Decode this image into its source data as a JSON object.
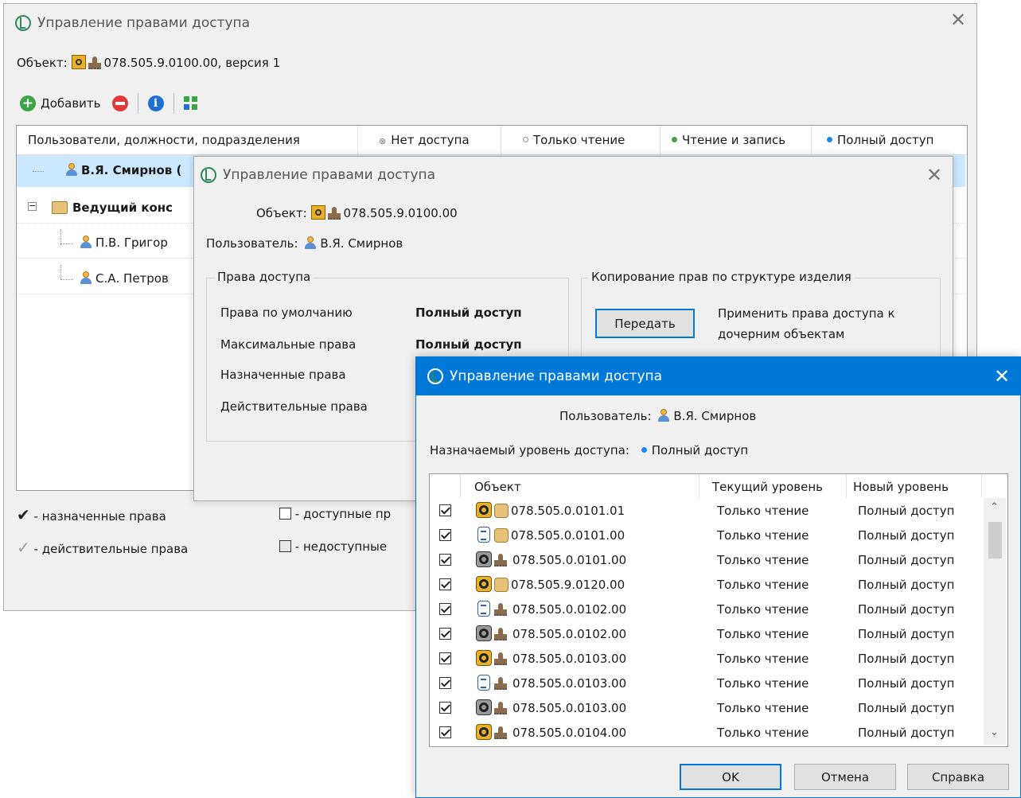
{
  "main_window": {
    "title": "Управление правами доступа",
    "object_label": "Объект:",
    "object_value": "078.505.9.0100.00, версия 1",
    "toolbar": {
      "add_label": "Добавить"
    },
    "columns": [
      "Пользователи, должности, подразделения",
      "Нет доступа",
      "Только чтение",
      "Чтение и запись",
      "Полный доступ"
    ],
    "tree": [
      {
        "label": "В.Я. Смирнов (",
        "type": "user"
      },
      {
        "label": "Ведущий конс",
        "type": "position"
      },
      {
        "label": "П.В. Григор",
        "type": "user"
      },
      {
        "label": "С.А. Петров",
        "type": "user"
      }
    ],
    "legend": {
      "assigned": "- назначенные права",
      "effective": "- действительные права",
      "available": "- доступные пр",
      "unavailable": "- недоступные"
    }
  },
  "second_window": {
    "title": "Управление правами доступа",
    "object_label": "Объект:",
    "object_value": "078.505.9.0100.00",
    "user_label": "Пользователь:",
    "user_value": "В.Я. Смирнов",
    "rights_group": "Права доступа",
    "rights": [
      {
        "label": "Права по умолчанию",
        "value": "Полный доступ"
      },
      {
        "label": "Максимальные права",
        "value": "Полный доступ"
      },
      {
        "label": "Назначенные права",
        "value": ""
      },
      {
        "label": "Действительные права",
        "value": ""
      }
    ],
    "copy_group": "Копирование прав по структуре изделия",
    "transfer_button": "Передать",
    "transfer_desc_1": "Применить права доступа к",
    "transfer_desc_2": "дочерним объектам"
  },
  "front_window": {
    "title": "Управление правами доступа",
    "user_label": "Пользователь:",
    "user_value": "В.Я. Смирнов",
    "level_label": "Назначаемый уровень доступа:",
    "level_value": "Полный доступ",
    "columns": {
      "object": "Объект",
      "current": "Текущий уровень",
      "new": "Новый уровень"
    },
    "rows": [
      {
        "icon1": "project-icon",
        "icon2": "box-icon",
        "name": "078.505.0.0101.01",
        "current": "Только чтение",
        "new": "Полный доступ",
        "checked": true
      },
      {
        "icon1": "document-icon",
        "icon2": "box-icon",
        "name": "078.505.0.0101.00",
        "current": "Только чтение",
        "new": "Полный доступ",
        "checked": true
      },
      {
        "icon1": "gray-project-icon",
        "icon2": "stamp-icon",
        "name": "078.505.0.0101.00",
        "current": "Только чтение",
        "new": "Полный доступ",
        "checked": true
      },
      {
        "icon1": "project-icon",
        "icon2": "box-icon",
        "name": "078.505.9.0120.00",
        "current": "Только чтение",
        "new": "Полный доступ",
        "checked": true
      },
      {
        "icon1": "document-icon",
        "icon2": "stamp-icon",
        "name": "078.505.0.0102.00",
        "current": "Только чтение",
        "new": "Полный доступ",
        "checked": true
      },
      {
        "icon1": "gray-project-icon",
        "icon2": "stamp-icon",
        "name": "078.505.0.0102.00",
        "current": "Только чтение",
        "new": "Полный доступ",
        "checked": true
      },
      {
        "icon1": "project-icon",
        "icon2": "stamp-icon",
        "name": "078.505.0.0103.00",
        "current": "Только чтение",
        "new": "Полный доступ",
        "checked": true
      },
      {
        "icon1": "document-icon",
        "icon2": "stamp-icon",
        "name": "078.505.0.0103.00",
        "current": "Только чтение",
        "new": "Полный доступ",
        "checked": true
      },
      {
        "icon1": "gray-project-icon",
        "icon2": "stamp-icon",
        "name": "078.505.0.0103.00",
        "current": "Только чтение",
        "new": "Полный доступ",
        "checked": true
      },
      {
        "icon1": "project-icon",
        "icon2": "stamp-icon",
        "name": "078.505.0.0104.00",
        "current": "Только чтение",
        "new": "Полный доступ",
        "checked": true
      }
    ],
    "buttons": {
      "ok": "OK",
      "cancel": "Отмена",
      "help": "Справка"
    }
  },
  "colors": {
    "accent": "#0078d7",
    "full_access": "#1e88e5",
    "read_write": "#43a047",
    "read_only": "#9e9e9e",
    "no_access": "#777777"
  }
}
